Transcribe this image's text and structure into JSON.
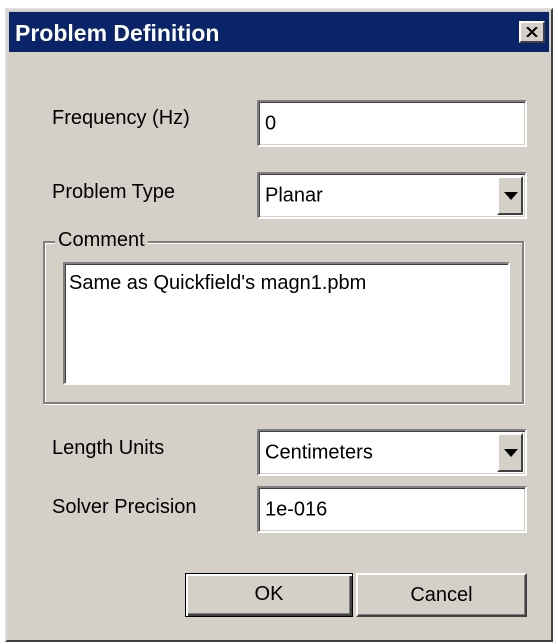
{
  "dialog": {
    "title": "Problem Definition",
    "close_icon": "close-icon"
  },
  "frequency": {
    "label": "Frequency (Hz)",
    "value": "0"
  },
  "problem_type": {
    "label": "Problem Type",
    "value": "Planar",
    "arrow_icon": "chevron-down-icon"
  },
  "comment": {
    "label": "Comment",
    "value": "Same as Quickfield's  magn1.pbm"
  },
  "length_units": {
    "label": "Length Units",
    "value": "Centimeters",
    "arrow_icon": "chevron-down-icon"
  },
  "solver_precision": {
    "label": "Solver Precision",
    "value": "1e-016"
  },
  "buttons": {
    "ok_label": "OK",
    "cancel_label": "Cancel"
  },
  "colors": {
    "titlebar": "#0a246a",
    "face": "#d4d0c8"
  }
}
